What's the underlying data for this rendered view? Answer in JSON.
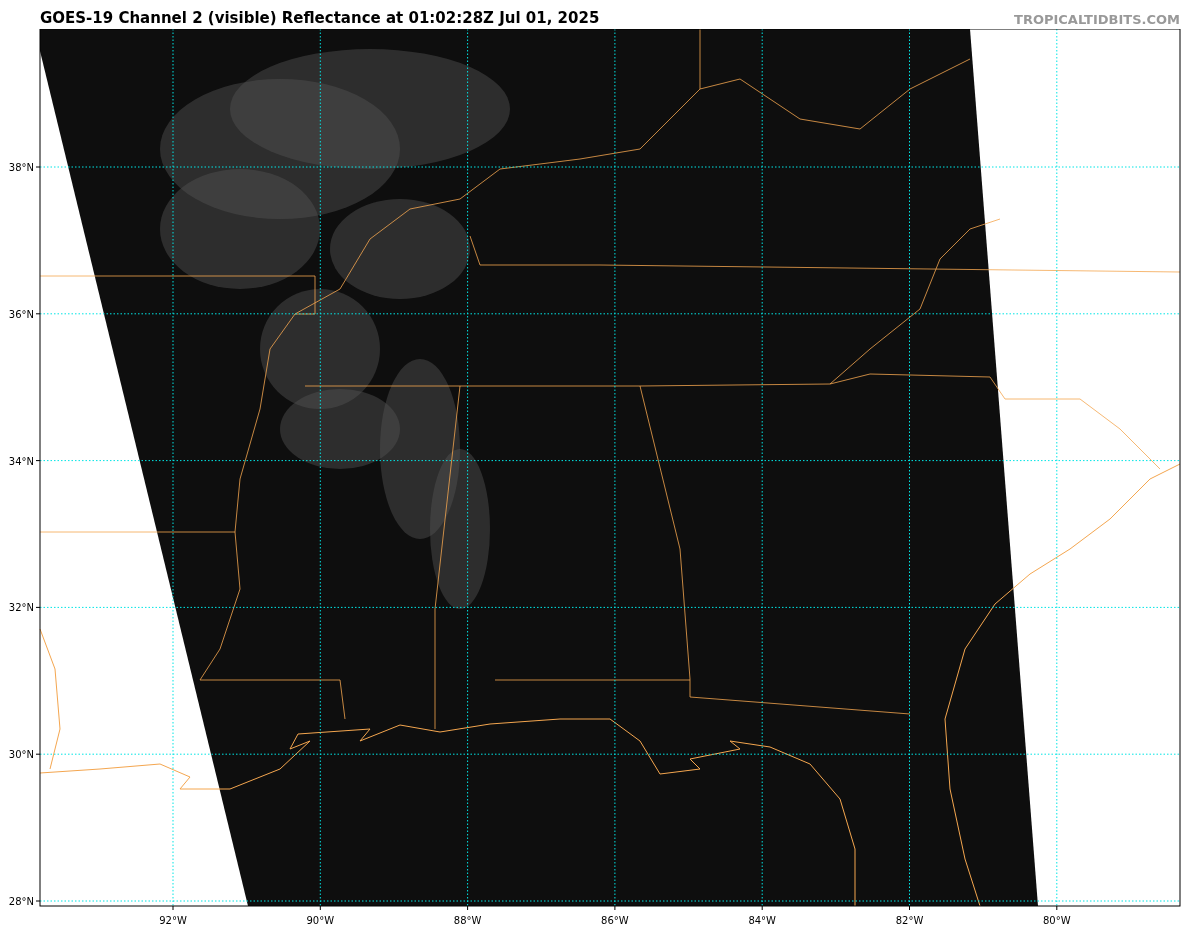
{
  "title": "GOES-19 Channel 2 (visible) Reflectance at 01:02:28Z Jul 01, 2025",
  "credit": "TROPICALTIDBITS.COM",
  "latitude_labels": [
    "38°N",
    "36°N",
    "34°N",
    "32°N",
    "30°N",
    "28°N"
  ],
  "longitude_labels": [
    "92°W",
    "90°W",
    "88°W",
    "86°W",
    "84°W",
    "82°W",
    "80°W"
  ]
}
